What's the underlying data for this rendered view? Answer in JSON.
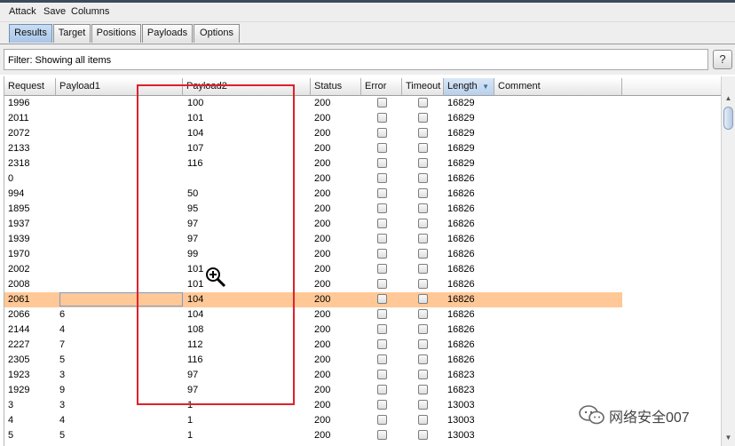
{
  "menu": [
    "Attack",
    "Save",
    "Columns"
  ],
  "tabs": [
    "Results",
    "Target",
    "Positions",
    "Payloads",
    "Options"
  ],
  "filter": {
    "text": "Filter: Showing all items",
    "help_label": "?"
  },
  "columns": [
    "Request",
    "Payload1",
    "Payload2",
    "Status",
    "Error",
    "Timeout",
    "Length",
    "Comment"
  ],
  "sorted_column": "Length",
  "rows": [
    {
      "request": "1996",
      "payload1": "",
      "payload2": "100",
      "status": "200",
      "length": "16829",
      "selected": false
    },
    {
      "request": "2011",
      "payload1": "",
      "payload2": "101",
      "status": "200",
      "length": "16829",
      "selected": false
    },
    {
      "request": "2072",
      "payload1": "",
      "payload2": "104",
      "status": "200",
      "length": "16829",
      "selected": false
    },
    {
      "request": "2133",
      "payload1": "",
      "payload2": "107",
      "status": "200",
      "length": "16829",
      "selected": false
    },
    {
      "request": "2318",
      "payload1": "",
      "payload2": "116",
      "status": "200",
      "length": "16829",
      "selected": false
    },
    {
      "request": "0",
      "payload1": "",
      "payload2": "",
      "status": "200",
      "length": "16826",
      "selected": false
    },
    {
      "request": "994",
      "payload1": "",
      "payload2": "50",
      "status": "200",
      "length": "16826",
      "selected": false
    },
    {
      "request": "1895",
      "payload1": "",
      "payload2": "95",
      "status": "200",
      "length": "16826",
      "selected": false
    },
    {
      "request": "1937",
      "payload1": "",
      "payload2": "97",
      "status": "200",
      "length": "16826",
      "selected": false
    },
    {
      "request": "1939",
      "payload1": "",
      "payload2": "97",
      "status": "200",
      "length": "16826",
      "selected": false
    },
    {
      "request": "1970",
      "payload1": "",
      "payload2": "99",
      "status": "200",
      "length": "16826",
      "selected": false
    },
    {
      "request": "2002",
      "payload1": "",
      "payload2": "101",
      "status": "200",
      "length": "16826",
      "selected": false
    },
    {
      "request": "2008",
      "payload1": "",
      "payload2": "101",
      "status": "200",
      "length": "16826",
      "selected": false
    },
    {
      "request": "2061",
      "payload1": "",
      "payload2": "104",
      "status": "200",
      "length": "16826",
      "selected": true
    },
    {
      "request": "2066",
      "payload1": "6",
      "payload2": "104",
      "status": "200",
      "length": "16826",
      "selected": false
    },
    {
      "request": "2144",
      "payload1": "4",
      "payload2": "108",
      "status": "200",
      "length": "16826",
      "selected": false
    },
    {
      "request": "2227",
      "payload1": "7",
      "payload2": "112",
      "status": "200",
      "length": "16826",
      "selected": false
    },
    {
      "request": "2305",
      "payload1": "5",
      "payload2": "116",
      "status": "200",
      "length": "16826",
      "selected": false
    },
    {
      "request": "1923",
      "payload1": "3",
      "payload2": "97",
      "status": "200",
      "length": "16823",
      "selected": false
    },
    {
      "request": "1929",
      "payload1": "9",
      "payload2": "97",
      "status": "200",
      "length": "16823",
      "selected": false
    },
    {
      "request": "3",
      "payload1": "3",
      "payload2": "1",
      "status": "200",
      "length": "13003",
      "selected": false
    },
    {
      "request": "4",
      "payload1": "4",
      "payload2": "1",
      "status": "200",
      "length": "13003",
      "selected": false
    },
    {
      "request": "5",
      "payload1": "5",
      "payload2": "1",
      "status": "200",
      "length": "13003",
      "selected": false
    }
  ],
  "watermark": "网络安全007",
  "colors": {
    "selected_row": "#ffc896",
    "highlight_box": "#e0202a",
    "active_tab": "#b8d0ec"
  },
  "icons": {
    "cursor": "zoom-in-cursor-icon",
    "watermark": "wechat-icon"
  }
}
